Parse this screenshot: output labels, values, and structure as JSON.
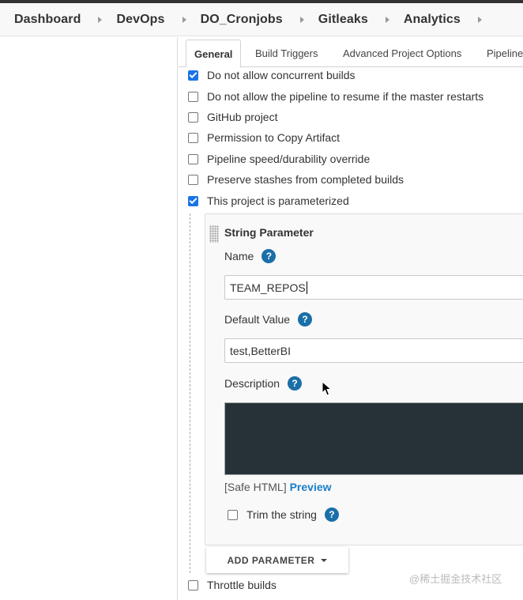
{
  "breadcrumb": {
    "items": [
      {
        "label": "Dashboard"
      },
      {
        "label": "DevOps"
      },
      {
        "label": "DO_Cronjobs"
      },
      {
        "label": "Gitleaks"
      },
      {
        "label": "Analytics"
      }
    ]
  },
  "tabs": {
    "general": "General",
    "build_triggers": "Build Triggers",
    "advanced": "Advanced Project Options",
    "pipeline": "Pipeline"
  },
  "options": {
    "concurrent": {
      "label": "Do not allow concurrent builds",
      "checked": true
    },
    "resume": {
      "label": "Do not allow the pipeline to resume if the master restarts",
      "checked": false
    },
    "github": {
      "label": "GitHub project",
      "checked": false
    },
    "copy_artifact": {
      "label": "Permission to Copy Artifact",
      "checked": false
    },
    "durability": {
      "label": "Pipeline speed/durability override",
      "checked": false
    },
    "stashes": {
      "label": "Preserve stashes from completed builds",
      "checked": false
    },
    "parameterized": {
      "label": "This project is parameterized",
      "checked": true
    },
    "throttle": {
      "label": "Throttle builds",
      "checked": false
    }
  },
  "parameter": {
    "title": "String Parameter",
    "name_label": "Name",
    "name_value": "TEAM_REPOS",
    "default_label": "Default Value",
    "default_value": "test,BetterBI",
    "description_label": "Description",
    "safe_html": "[Safe HTML]",
    "preview": "Preview",
    "trim_label": "Trim the string",
    "trim_checked": false,
    "help_symbol": "?"
  },
  "add_parameter": "ADD PARAMETER",
  "watermark": "@稀土掘金技术社区",
  "colors": {
    "accent": "#1a73e8",
    "help": "#1a6fa8",
    "link": "#1a7ec8",
    "editor_bg": "#263238"
  }
}
